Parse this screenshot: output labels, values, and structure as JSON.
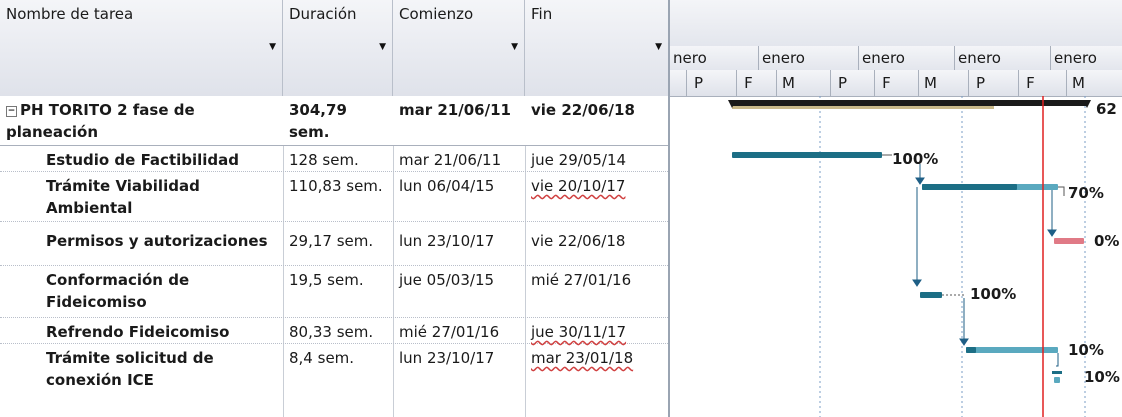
{
  "columns": {
    "name": "Nombre de tarea",
    "duration": "Duración",
    "start": "Comienzo",
    "end": "Fin"
  },
  "tasks": [
    {
      "name": "PH TORITO 2 fase de planeación",
      "duration": "304,79 sem.",
      "start": "mar 21/06/11",
      "end": "vie 22/06/18",
      "summary": true,
      "progress_label": "62"
    },
    {
      "name": "Estudio de Factibilidad",
      "duration": "128 sem.",
      "start": "mar 21/06/11",
      "end": "jue 29/05/14",
      "progress_label": "100%",
      "progress": 1.0
    },
    {
      "name": "Trámite Viabilidad Ambiental",
      "duration": "110,83 sem.",
      "start": "lun 06/04/15",
      "end": "vie 20/10/17",
      "progress_label": "70%",
      "progress": 0.7
    },
    {
      "name": "Permisos y autorizaciones",
      "duration": "29,17 sem.",
      "start": "lun 23/10/17",
      "end": "vie 22/06/18",
      "progress_label": "0%",
      "progress": 0.0
    },
    {
      "name": "Conformación de Fideicomiso",
      "duration": "19,5 sem.",
      "start": "jue 05/03/15",
      "end": "mié 27/01/16",
      "progress_label": "100%",
      "progress": 1.0
    },
    {
      "name": "Refrendo Fideicomiso",
      "duration": "80,33 sem.",
      "start": "mié 27/01/16",
      "end": "jue 30/11/17",
      "progress_label": "10%",
      "progress": 0.1
    },
    {
      "name": "Trámite solicitud de conexión ICE",
      "duration": "8,4 sem.",
      "start": "lun 23/10/17",
      "end": "mar 23/01/18",
      "progress_label": "10%",
      "progress": 0.1
    }
  ],
  "timescale": {
    "months": [
      "nero",
      "enero",
      "enero",
      "enero",
      "enero"
    ],
    "units": [
      "P",
      "F",
      "M",
      "P",
      "F",
      "M",
      "P",
      "F",
      "M"
    ]
  },
  "colors": {
    "summary_bar": "#1a1a1a",
    "task_bar": "#5aa9bf",
    "task_progress": "#1c6e85",
    "critical_bar": "#e07a86",
    "status_line": "#e02020",
    "link_line": "#1f5f86"
  }
}
